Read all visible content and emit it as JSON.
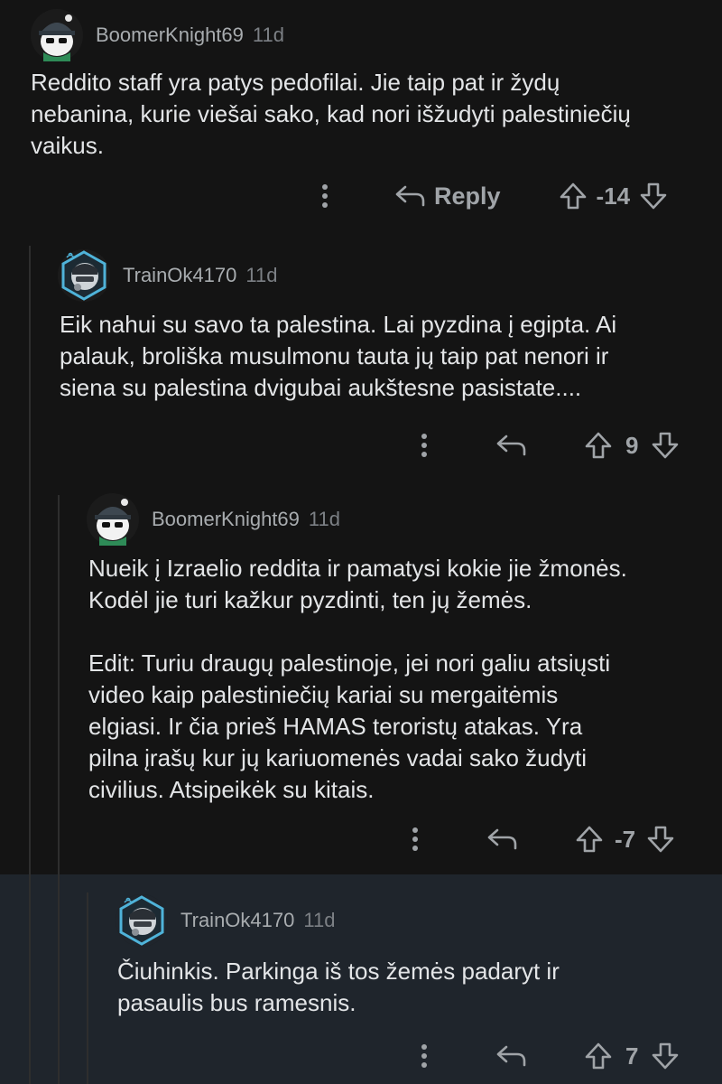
{
  "comments": [
    {
      "username": "BoomerKnight69",
      "age": "11d",
      "body": [
        "Reddito staff yra patys pedofilai. Jie taip pat ir žydų",
        "nebanina, kurie viešai sako, kad nori išžudyti palestiniečių",
        "vaikus."
      ],
      "reply_label": "Reply",
      "score": "-14"
    },
    {
      "username": "TrainOk4170",
      "age": "11d",
      "body": [
        "Eik nahui su savo ta palestina. Lai pyzdina į egipta. Ai",
        "palauk, broliška musulmonu tauta jų taip pat nenori ir",
        "siena su palestina dvigubai aukštesne pasistate...."
      ],
      "score": "9"
    },
    {
      "username": "BoomerKnight69",
      "age": "11d",
      "body": [
        "Nueik į Izraelio reddita ir pamatysi kokie jie žmonės.",
        "Kodėl jie turi kažkur pyzdinti, ten jų žemės.",
        "",
        "Edit: Turiu draugų palestinoje, jei nori galiu atsiųsti",
        "video kaip palestiniečių kariai su mergaitėmis",
        "elgiasi. Ir čia prieš HAMAS teroristų atakas. Yra",
        "pilna įrašų kur jų kariuomenės vadai sako žudyti",
        "civilius. Atsipeikėk su kitais."
      ],
      "score": "-7"
    },
    {
      "username": "TrainOk4170",
      "age": "11d",
      "body": [
        "Čiuhinkis. Parkinga iš tos žemės padaryt ir",
        "pasaulis bus ramesnis."
      ],
      "score": "7"
    }
  ],
  "icons": {
    "more": "vertical-ellipsis-icon",
    "reply": "reply-arrow-icon",
    "upvote": "upvote-arrow-icon",
    "downvote": "downvote-arrow-icon",
    "avatar_1": "panda-beanie-avatar",
    "avatar_2": "robot-helmet-avatar"
  },
  "colors": {
    "background": "#141414",
    "highlight_background": "#1f252c",
    "text": "#e3e5e7",
    "meta": "#a8acaf"
  }
}
